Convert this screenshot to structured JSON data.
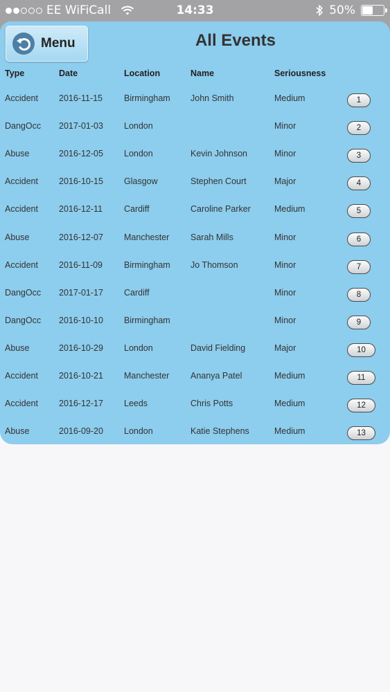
{
  "status_bar": {
    "carrier": "EE WiFiCall",
    "time": "14:33",
    "battery": "50%",
    "battery_level": 0.5,
    "signal_bars_filled": 2,
    "signal_bars_total": 5,
    "icons": [
      "wifi-icon",
      "bluetooth-icon",
      "battery-icon"
    ]
  },
  "header": {
    "menu_label": "Menu",
    "menu_icon": "back-arrow-icon",
    "title": "All Events"
  },
  "colors": {
    "panel": "#8dcded",
    "status_bar": "#a3a3a6",
    "background": "#f7f7f9"
  },
  "table": {
    "columns": [
      "Type",
      "Date",
      "Location",
      "Name",
      "Seriousness"
    ],
    "rows": [
      {
        "type": "Accident",
        "date": "2016-11-15",
        "location": "Birmingham",
        "name": "John Smith",
        "seriousness": "Medium",
        "id": "1"
      },
      {
        "type": "DangOcc",
        "date": "2017-01-03",
        "location": "London",
        "name": "",
        "seriousness": "Minor",
        "id": "2"
      },
      {
        "type": "Abuse",
        "date": "2016-12-05",
        "location": "London",
        "name": "Kevin Johnson",
        "seriousness": "Minor",
        "id": "3"
      },
      {
        "type": "Accident",
        "date": "2016-10-15",
        "location": "Glasgow",
        "name": "Stephen Court",
        "seriousness": "Major",
        "id": "4"
      },
      {
        "type": "Accident",
        "date": "2016-12-11",
        "location": "Cardiff",
        "name": "Caroline Parker",
        "seriousness": "Medium",
        "id": "5"
      },
      {
        "type": "Abuse",
        "date": "2016-12-07",
        "location": "Manchester",
        "name": "Sarah Mills",
        "seriousness": "Minor",
        "id": "6"
      },
      {
        "type": "Accident",
        "date": "2016-11-09",
        "location": "Birmingham",
        "name": "Jo Thomson",
        "seriousness": "Minor",
        "id": "7"
      },
      {
        "type": "DangOcc",
        "date": "2017-01-17",
        "location": "Cardiff",
        "name": "",
        "seriousness": "Minor",
        "id": "8"
      },
      {
        "type": "DangOcc",
        "date": "2016-10-10",
        "location": "Birmingham",
        "name": "",
        "seriousness": "Minor",
        "id": "9"
      },
      {
        "type": "Abuse",
        "date": "2016-10-29",
        "location": "London",
        "name": "David Fielding",
        "seriousness": "Major",
        "id": "10"
      },
      {
        "type": "Accident",
        "date": "2016-10-21",
        "location": "Manchester",
        "name": "Ananya Patel",
        "seriousness": "Medium",
        "id": "11"
      },
      {
        "type": "Accident",
        "date": "2016-12-17",
        "location": "Leeds",
        "name": "Chris Potts",
        "seriousness": "Medium",
        "id": "12"
      },
      {
        "type": "Abuse",
        "date": "2016-09-20",
        "location": "London",
        "name": "Katie Stephens",
        "seriousness": "Medium",
        "id": "13"
      }
    ]
  }
}
